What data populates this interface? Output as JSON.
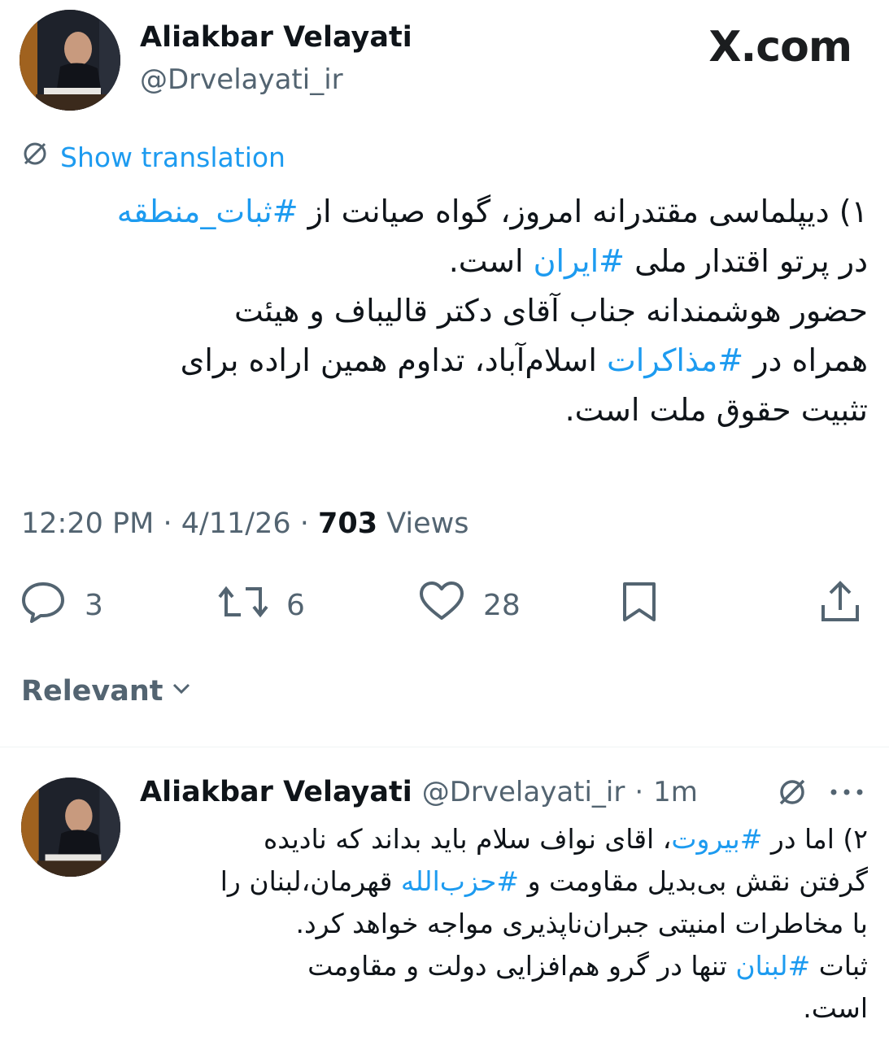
{
  "site_logo": "X.com",
  "main_tweet": {
    "author_name": "Aliakbar Velayati",
    "author_handle": "@Drvelayati_ir",
    "show_translation": "Show translation",
    "lines": [
      [
        "۱) دیپلماسی مقتدرانه امروز، گواه صیانت از ",
        {
          "tag": "#ثبات_منطقه"
        }
      ],
      [
        "در پرتو اقتدار ملی ",
        {
          "tag": "#ایران"
        },
        " است."
      ],
      [
        " حضور هوشمندانه جناب آقای دکتر قالیباف و هیئت"
      ],
      [
        "همراه در ",
        {
          "tag": "#مذاکرات"
        },
        " اسلام‌آباد، تداوم همین اراده برای"
      ],
      [
        "تثبیت حقوق ملت است."
      ]
    ],
    "time": "12:20 PM",
    "date": "4/11/26",
    "views_count": "703",
    "views_label": "Views",
    "replies": "3",
    "reposts": "6",
    "likes": "28"
  },
  "sort": {
    "label": "Relevant"
  },
  "reply_tweet": {
    "author_name": "Aliakbar Velayati",
    "author_handle": "@Drvelayati_ir",
    "time_ago": "1m",
    "lines": [
      [
        "۲)  اما در ",
        {
          "tag": "#بیروت"
        },
        "، اقای نواف سلام باید بداند که نادیده"
      ],
      [
        "گرفتن نقش بی‌بدیل مقاومت و ",
        {
          "tag": "#حزب‌الله"
        },
        " قهرمان،لبنان را"
      ],
      [
        "با مخاطرات امنیتی جبران‌ناپذیری مواجه خواهد کرد."
      ],
      [
        "ثبات ",
        {
          "tag": "#لبنان"
        },
        "  تنها در گرو هم‌افزایی دولت و مقاومت"
      ],
      [
        "است."
      ]
    ]
  },
  "icons": [
    "translate-icon",
    "reply-icon",
    "repost-icon",
    "like-icon",
    "bookmark-icon",
    "share-icon",
    "chevron-down-icon",
    "more-icon"
  ],
  "colors": {
    "link": "#1d9bf0",
    "text": "#0f1419",
    "muted": "#536471"
  }
}
